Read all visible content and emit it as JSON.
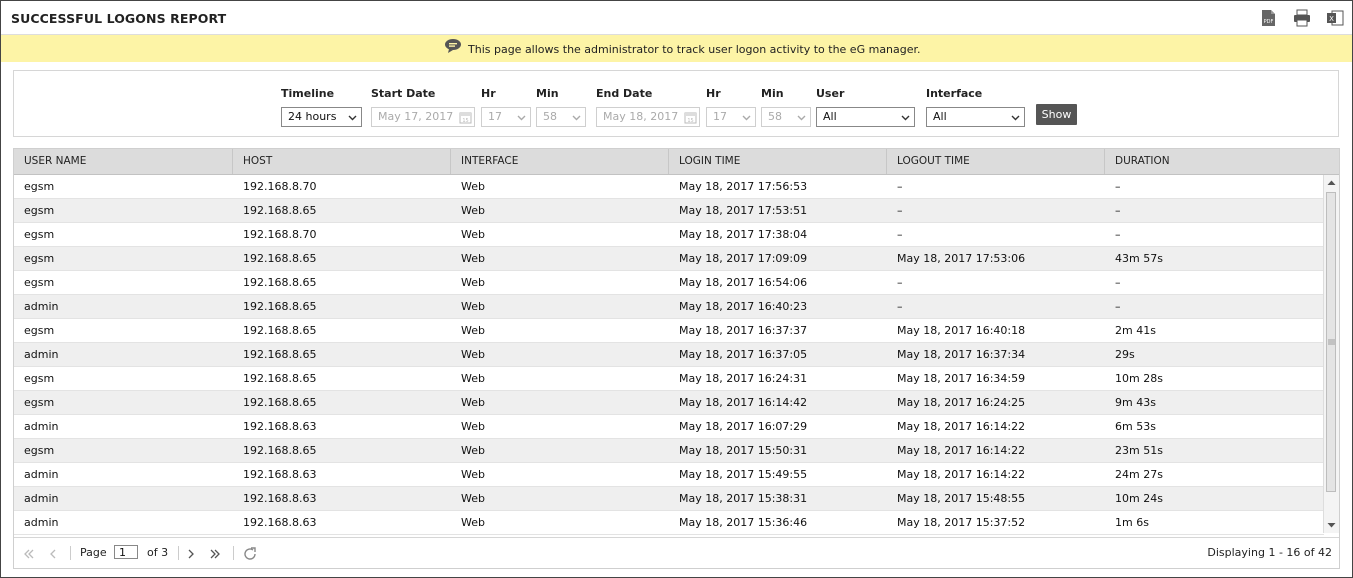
{
  "header": {
    "title": "SUCCESSFUL LOGONS REPORT",
    "icons": [
      "pdf-icon",
      "print-icon",
      "excel-icon"
    ]
  },
  "notice": {
    "text": "This page allows the administrator to track user logon activity to the eG manager."
  },
  "filters": {
    "timeline": {
      "label": "Timeline",
      "value": "24 hours"
    },
    "start_date": {
      "label": "Start Date",
      "value": "May 17, 2017"
    },
    "start_hr": {
      "label": "Hr",
      "value": "17"
    },
    "start_min": {
      "label": "Min",
      "value": "58"
    },
    "end_date": {
      "label": "End Date",
      "value": "May 18, 2017"
    },
    "end_hr": {
      "label": "Hr",
      "value": "17"
    },
    "end_min": {
      "label": "Min",
      "value": "58"
    },
    "user": {
      "label": "User",
      "value": "All"
    },
    "interface": {
      "label": "Interface",
      "value": "All"
    },
    "show_label": "Show"
  },
  "table": {
    "columns": [
      "USER NAME",
      "HOST",
      "INTERFACE",
      "LOGIN TIME",
      "LOGOUT TIME",
      "DURATION"
    ],
    "rows": [
      [
        "egsm",
        "192.168.8.70",
        "Web",
        "May 18, 2017 17:56:53",
        "–",
        "–"
      ],
      [
        "egsm",
        "192.168.8.65",
        "Web",
        "May 18, 2017 17:53:51",
        "–",
        "–"
      ],
      [
        "egsm",
        "192.168.8.70",
        "Web",
        "May 18, 2017 17:38:04",
        "–",
        "–"
      ],
      [
        "egsm",
        "192.168.8.65",
        "Web",
        "May 18, 2017 17:09:09",
        "May 18, 2017 17:53:06",
        "43m 57s"
      ],
      [
        "egsm",
        "192.168.8.65",
        "Web",
        "May 18, 2017 16:54:06",
        "–",
        "–"
      ],
      [
        "admin",
        "192.168.8.65",
        "Web",
        "May 18, 2017 16:40:23",
        "–",
        "–"
      ],
      [
        "egsm",
        "192.168.8.65",
        "Web",
        "May 18, 2017 16:37:37",
        "May 18, 2017 16:40:18",
        "2m 41s"
      ],
      [
        "admin",
        "192.168.8.65",
        "Web",
        "May 18, 2017 16:37:05",
        "May 18, 2017 16:37:34",
        "29s"
      ],
      [
        "egsm",
        "192.168.8.65",
        "Web",
        "May 18, 2017 16:24:31",
        "May 18, 2017 16:34:59",
        "10m 28s"
      ],
      [
        "egsm",
        "192.168.8.65",
        "Web",
        "May 18, 2017 16:14:42",
        "May 18, 2017 16:24:25",
        "9m 43s"
      ],
      [
        "admin",
        "192.168.8.63",
        "Web",
        "May 18, 2017 16:07:29",
        "May 18, 2017 16:14:22",
        "6m 53s"
      ],
      [
        "egsm",
        "192.168.8.65",
        "Web",
        "May 18, 2017 15:50:31",
        "May 18, 2017 16:14:22",
        "23m 51s"
      ],
      [
        "admin",
        "192.168.8.63",
        "Web",
        "May 18, 2017 15:49:55",
        "May 18, 2017 16:14:22",
        "24m 27s"
      ],
      [
        "admin",
        "192.168.8.63",
        "Web",
        "May 18, 2017 15:38:31",
        "May 18, 2017 15:48:55",
        "10m 24s"
      ],
      [
        "admin",
        "192.168.8.63",
        "Web",
        "May 18, 2017 15:36:46",
        "May 18, 2017 15:37:52",
        "1m 6s"
      ]
    ]
  },
  "pager": {
    "page_label": "Page",
    "page_value": "1",
    "of_label": "of 3",
    "display_text": "Displaying 1 - 16 of 42"
  }
}
